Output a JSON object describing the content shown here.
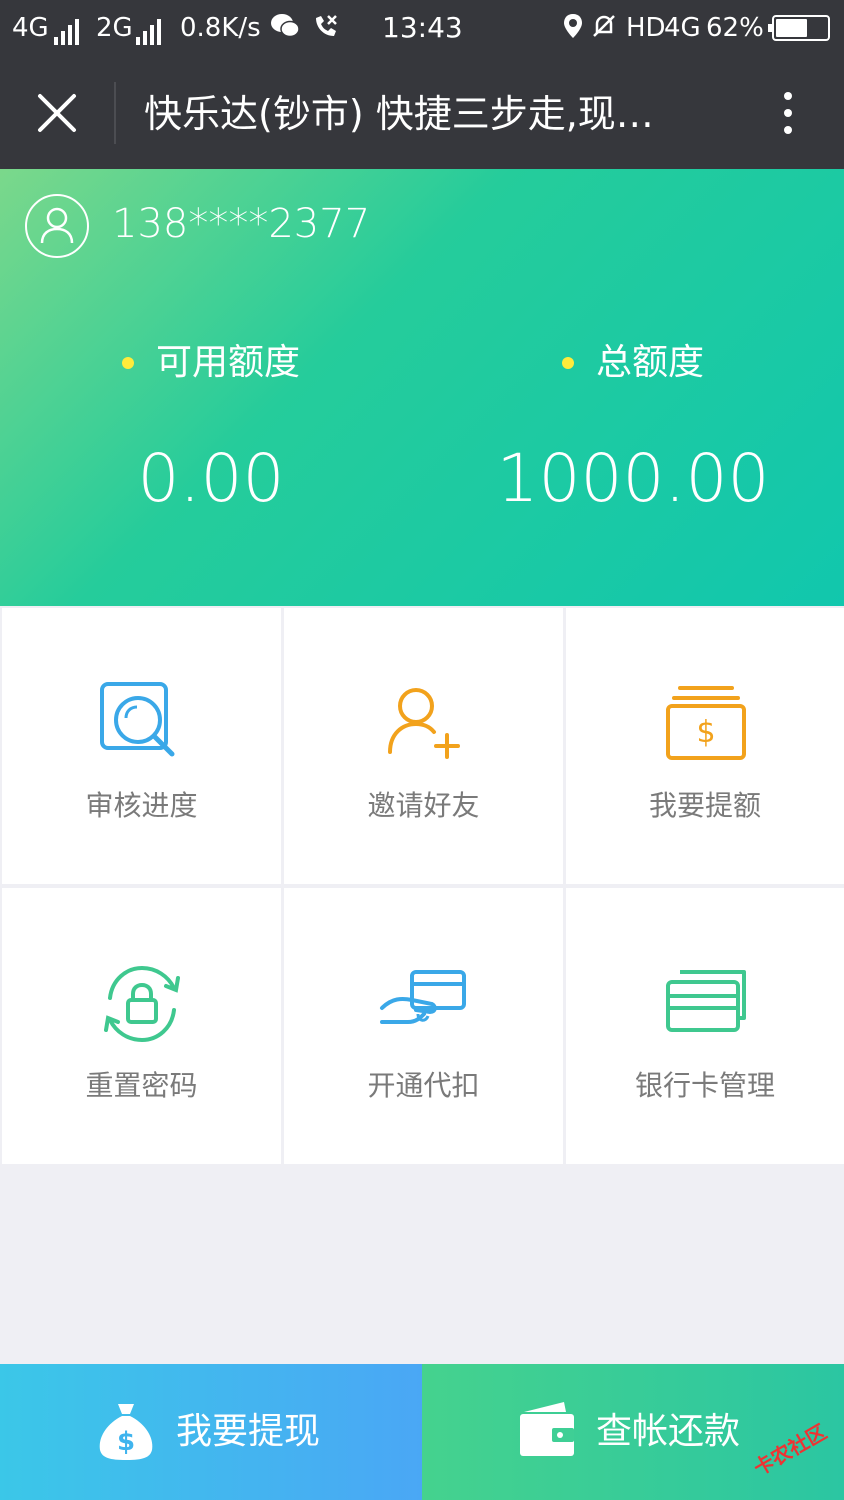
{
  "status_bar": {
    "net1": "4G",
    "net2": "2G",
    "speed": "0.8K/s",
    "time": "13:43",
    "hd": "HD",
    "net3": "4G",
    "battery": "62%",
    "battery_level": 0.62
  },
  "nav": {
    "title": "快乐达(钞市) 快捷三步走,现…"
  },
  "account": {
    "phone": "138****2377"
  },
  "limits": {
    "available_label": "可用额度",
    "available_value": "0.00",
    "total_label": "总额度",
    "total_value": "1000.00"
  },
  "grid": [
    {
      "label": "审核进度",
      "icon": "review-progress-icon",
      "color": "#3aa8e8"
    },
    {
      "label": "邀请好友",
      "icon": "invite-friend-icon",
      "color": "#f2a21c"
    },
    {
      "label": "我要提额",
      "icon": "raise-limit-icon",
      "color": "#f2a21c"
    },
    {
      "label": "重置密码",
      "icon": "reset-password-icon",
      "color": "#3fc88f"
    },
    {
      "label": "开通代扣",
      "icon": "auto-debit-icon",
      "color": "#3aa8e8"
    },
    {
      "label": "银行卡管理",
      "icon": "bank-card-icon",
      "color": "#3fc88f"
    }
  ],
  "bottom": {
    "withdraw_label": "我要提现",
    "bill_label": "查帐还款"
  },
  "watermark": "卡农社区"
}
